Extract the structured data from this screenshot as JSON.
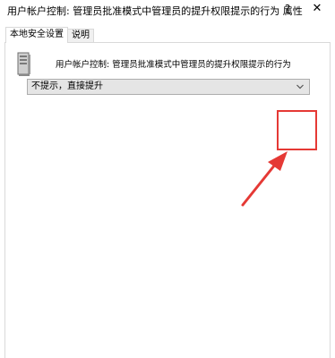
{
  "window": {
    "title": "用户帐户控制: 管理员批准模式中管理员的提升权限提示的行为 属性",
    "help_label": "?",
    "close_label": "✕"
  },
  "tabs": [
    {
      "label": "本地安全设置",
      "active": true
    },
    {
      "label": "说明",
      "active": false
    }
  ],
  "policy": {
    "icon": "server-policy-icon",
    "name": "用户帐户控制: 管理员批准模式中管理员的提升权限提示的行为"
  },
  "setting_select": {
    "selected": "不提示，直接提升",
    "icon": "chevron-down-icon"
  },
  "colors": {
    "annotation": "#e53935",
    "select_bg": "#e5e5e5",
    "border": "#d9d9d9"
  }
}
